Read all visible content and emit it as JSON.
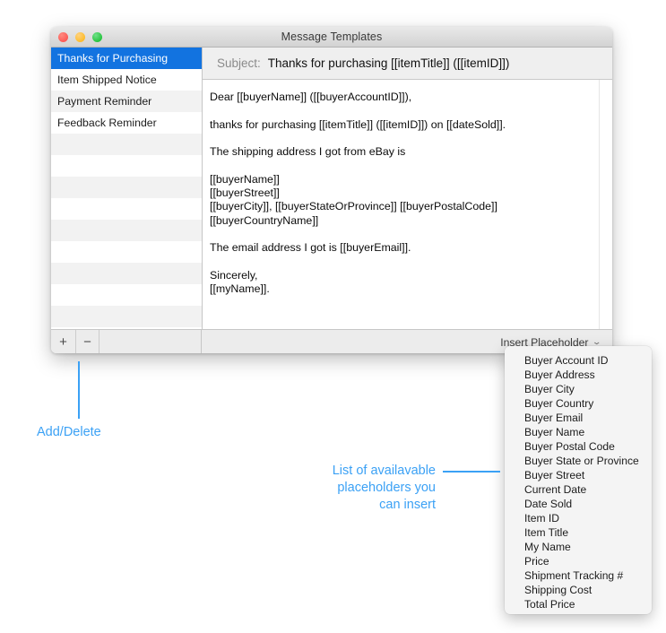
{
  "window": {
    "title": "Message Templates",
    "traffic_lights": [
      "close-button",
      "minimize-button",
      "maximize-button"
    ]
  },
  "sidebar": {
    "items": [
      {
        "label": "Thanks for Purchasing",
        "selected": true
      },
      {
        "label": "Item Shipped Notice",
        "selected": false
      },
      {
        "label": "Payment Reminder",
        "selected": false
      },
      {
        "label": "Feedback Reminder",
        "selected": false
      }
    ],
    "empty_row_count": 9
  },
  "subject": {
    "label": "Subject:",
    "value": "Thanks for purchasing [[itemTitle]] ([[itemID]])"
  },
  "body": {
    "text": "Dear [[buyerName]] ([[buyerAccountID]]),\n\nthanks for purchasing [[itemTitle]] ([[itemID]]) on [[dateSold]].\n\nThe shipping address I got from eBay is\n\n[[buyerName]]\n[[buyerStreet]]\n[[buyerCity]], [[buyerStateOrProvince]] [[buyerPostalCode]]\n[[buyerCountryName]]\n\nThe email address I got is [[buyerEmail]].\n\nSincerely,\n[[myName]]."
  },
  "toolbar": {
    "add_label": "+",
    "delete_label": "−",
    "insert_placeholder_label": "Insert Placeholder",
    "chevron_glyph": "⌄"
  },
  "placeholder_menu": {
    "items": [
      "Buyer Account ID",
      "Buyer Address",
      "Buyer City",
      "Buyer Country",
      "Buyer Email",
      "Buyer Name",
      "Buyer Postal Code",
      "Buyer State or Province",
      "Buyer Street",
      "Current Date",
      "Date Sold",
      "Item ID",
      "Item Title",
      "My Name",
      "Price",
      "Shipment Tracking #",
      "Shipping Cost",
      "Total Price"
    ]
  },
  "annotations": {
    "add_delete": "Add/Delete",
    "placeholder_list": "List of availavable\nplaceholders you\ncan insert",
    "color": "#3ba1f5"
  }
}
